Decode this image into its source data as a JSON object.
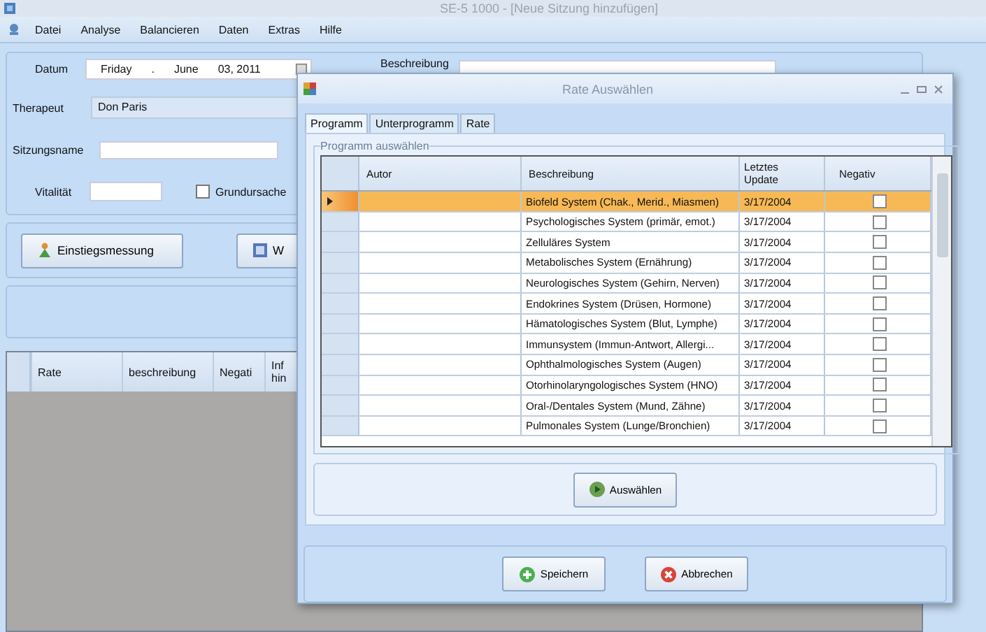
{
  "window": {
    "title": "SE-5 1000 - [Neue Sitzung hinzufügen]"
  },
  "menu": [
    "Datei",
    "Analyse",
    "Balancieren",
    "Daten",
    "Extras",
    "Hilfe"
  ],
  "form": {
    "date_label": "Datum",
    "date_parts": [
      "Friday",
      ".",
      "June",
      "03, 2011"
    ],
    "therapist_label": "Therapeut",
    "therapist": "Don Paris",
    "session_label": "Sitzungsname",
    "vitality_label": "Vitalität",
    "root_cause": {
      "label": "Grundursache",
      "checked": false
    },
    "description_label": "Beschreibung"
  },
  "buttons": [
    "Einstiegsmessung",
    "W"
  ],
  "grid": {
    "columns": [
      "Rate",
      "beschreibung",
      "Negati",
      "Inf\nhin"
    ]
  },
  "dialog": {
    "title": "Rate Auswählen",
    "tabs": [
      {
        "label": "Programm",
        "selected": true
      },
      {
        "label": "Unterprogramm",
        "selected": false
      },
      {
        "label": "Rate",
        "selected": false
      }
    ],
    "group": "Programm auswählen",
    "columns": [
      "Autor",
      "Beschreibung",
      "Letztes\nUpdate",
      "Negativ"
    ],
    "rows": [
      {
        "description": "Biofeld System (Chak., Merid., Miasmen)",
        "updated": "3/17/2004",
        "negative": false,
        "selected": true
      },
      {
        "description": "Psychologisches System (primär, emot.)",
        "updated": "3/17/2004",
        "negative": false,
        "selected": false
      },
      {
        "description": "Zelluläres System",
        "updated": "3/17/2004",
        "negative": false,
        "selected": false
      },
      {
        "description": "Metabolisches System (Ernährung)",
        "updated": "3/17/2004",
        "negative": false,
        "selected": false
      },
      {
        "description": "Neurologisches System (Gehirn, Nerven)",
        "updated": "3/17/2004",
        "negative": false,
        "selected": false
      },
      {
        "description": "Endokrines System (Drüsen, Hormone)",
        "updated": "3/17/2004",
        "negative": false,
        "selected": false
      },
      {
        "description": "Hämatologisches System (Blut, Lymphe)",
        "updated": "3/17/2004",
        "negative": false,
        "selected": false
      },
      {
        "description": "Immunsystem (Immun-Antwort, Allergi...",
        "updated": "3/17/2004",
        "negative": false,
        "selected": false
      },
      {
        "description": "Ophthalmologisches System (Augen)",
        "updated": "3/17/2004",
        "negative": false,
        "selected": false
      },
      {
        "description": "Otorhinolaryngologisches System (HNO)",
        "updated": "3/17/2004",
        "negative": false,
        "selected": false
      },
      {
        "description": "Oral-/Dentales System (Mund, Zähne)",
        "updated": "3/17/2004",
        "negative": false,
        "selected": false
      },
      {
        "description": "Pulmonales System (Lunge/Bronchien)",
        "updated": "3/17/2004",
        "negative": false,
        "selected": false
      }
    ],
    "select_button": "Auswählen",
    "footer": [
      "Speichern",
      "Abbrechen"
    ]
  }
}
